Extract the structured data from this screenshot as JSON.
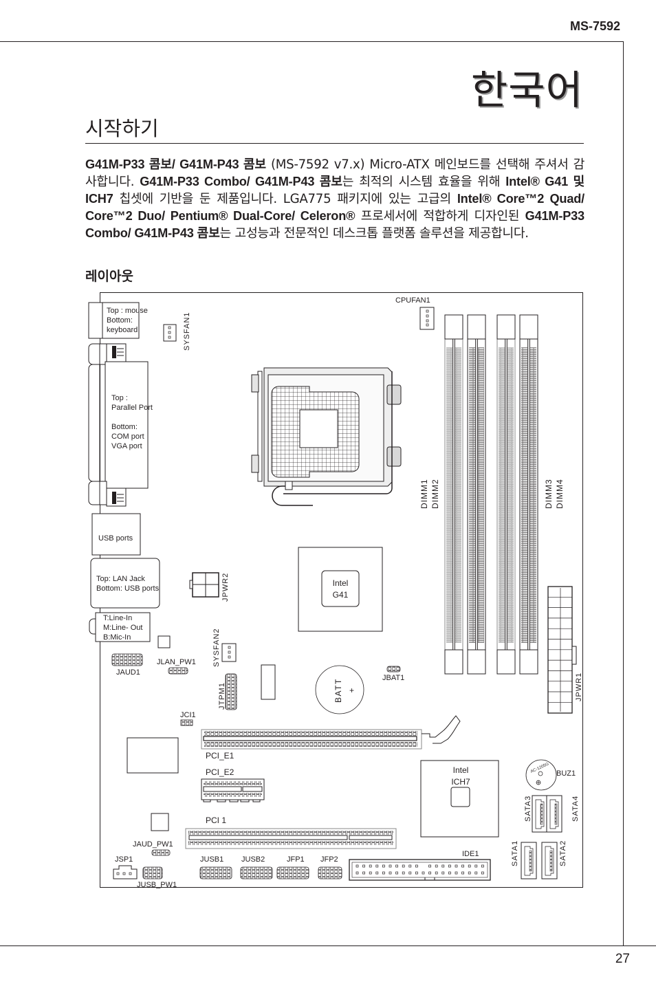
{
  "header": {
    "model": "MS-7592"
  },
  "page": {
    "number": "27",
    "language_title": "한국어"
  },
  "section": {
    "title": "시작하기",
    "intro_segments": [
      {
        "b": true,
        "t": "G41M-P33 콤보/ G41M-P43 콤보"
      },
      {
        "b": false,
        "t": " (MS-7592 v7.x) Micro-ATX 메인보드를 선택해 주셔서 감사합니다. "
      },
      {
        "b": true,
        "t": "G41M-P33 Combo/ G41M-P43 콤보"
      },
      {
        "b": false,
        "t": "는 최적의 시스템 효율을 위해 "
      },
      {
        "b": true,
        "t": "Intel® G41 및 ICH7"
      },
      {
        "b": false,
        "t": " 칩셋에 기반을 둔 제품입니다. LGA775 패키지에 있는 고급의 "
      },
      {
        "b": true,
        "t": "Intel® Core™2 Quad/ Core™2 Duo/ Pentium® Dual-Core/ Celeron®"
      },
      {
        "b": false,
        "t": " 프로세서에 적합하게 디자인된 "
      },
      {
        "b": true,
        "t": "G41M-P33 Combo/ G41M-P43 콤보"
      },
      {
        "b": false,
        "t": "는 고성능과 전문적인 데스크톱 플랫폼 솔루션을 제공합니다."
      }
    ],
    "layout_title": "레이아웃"
  },
  "board": {
    "io_labels": {
      "ps2": [
        "Top : mouse",
        "Bottom:",
        "keyboard"
      ],
      "parallel": [
        "Top :",
        "Parallel Port",
        "",
        "Bottom:",
        "COM port",
        "VGA port"
      ],
      "usb": "USB ports",
      "lan": [
        "Top: LAN Jack",
        "Bottom: USB ports"
      ],
      "audio": [
        "T:Line-In",
        "M:Line- Out",
        "B:Mic-In"
      ]
    },
    "chips": {
      "northbridge": [
        "Intel",
        "G41"
      ],
      "southbridge": [
        "Intel",
        "ICH7"
      ],
      "battery": "BATT",
      "battery_plus": "+",
      "buzzer_marking": "AC-1205G"
    },
    "connectors": {
      "sysfan1": "SYSFAN1",
      "cpufan1": "CPUFAN1",
      "dimm12": [
        "DIMM1",
        "DIMM2"
      ],
      "dimm34": [
        "DIMM3",
        "DIMM4"
      ],
      "jpwr2": "JPWR2",
      "jpwr1": "JPWR1",
      "sysfan2": "SYSFAN2",
      "jaud1": "JAUD1",
      "jlan_pw1": "JLAN_PW1",
      "jtpm1": "JTPM1",
      "jbat1": "JBAT1",
      "jci1": "JCI1",
      "pci_e1": "PCI_E1",
      "pci_e2": "PCI_E2",
      "pci1": "PCI 1",
      "buz1": "BUZ1",
      "sata1": "SATA1",
      "sata2": "SATA2",
      "sata3": "SATA3",
      "sata4": "SATA4",
      "jaud_pw1": "JAUD_PW1",
      "jsp1": "JSP1",
      "jusb_pw1": "JUSB_PW1",
      "jusb1": "JUSB1",
      "jusb2": "JUSB2",
      "jfp1": "JFP1",
      "jfp2": "JFP2",
      "ide1": "IDE1"
    }
  }
}
